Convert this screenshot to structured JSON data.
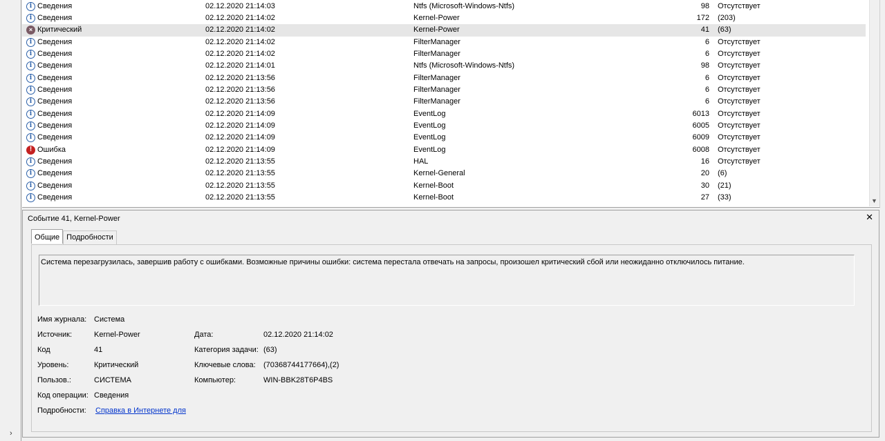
{
  "events": [
    {
      "level": "Сведения",
      "type": "info",
      "date": "02.12.2020 21:14:03",
      "source": "Ntfs (Microsoft-Windows-Ntfs)",
      "id": "98",
      "category": "Отсутствует"
    },
    {
      "level": "Сведения",
      "type": "info",
      "date": "02.12.2020 21:14:02",
      "source": "Kernel-Power",
      "id": "172",
      "category": "(203)"
    },
    {
      "level": "Критический",
      "type": "crit",
      "date": "02.12.2020 21:14:02",
      "source": "Kernel-Power",
      "id": "41",
      "category": "(63)",
      "selected": true
    },
    {
      "level": "Сведения",
      "type": "info",
      "date": "02.12.2020 21:14:02",
      "source": "FilterManager",
      "id": "6",
      "category": "Отсутствует"
    },
    {
      "level": "Сведения",
      "type": "info",
      "date": "02.12.2020 21:14:02",
      "source": "FilterManager",
      "id": "6",
      "category": "Отсутствует"
    },
    {
      "level": "Сведения",
      "type": "info",
      "date": "02.12.2020 21:14:01",
      "source": "Ntfs (Microsoft-Windows-Ntfs)",
      "id": "98",
      "category": "Отсутствует"
    },
    {
      "level": "Сведения",
      "type": "info",
      "date": "02.12.2020 21:13:56",
      "source": "FilterManager",
      "id": "6",
      "category": "Отсутствует"
    },
    {
      "level": "Сведения",
      "type": "info",
      "date": "02.12.2020 21:13:56",
      "source": "FilterManager",
      "id": "6",
      "category": "Отсутствует"
    },
    {
      "level": "Сведения",
      "type": "info",
      "date": "02.12.2020 21:13:56",
      "source": "FilterManager",
      "id": "6",
      "category": "Отсутствует"
    },
    {
      "level": "Сведения",
      "type": "info",
      "date": "02.12.2020 21:14:09",
      "source": "EventLog",
      "id": "6013",
      "category": "Отсутствует"
    },
    {
      "level": "Сведения",
      "type": "info",
      "date": "02.12.2020 21:14:09",
      "source": "EventLog",
      "id": "6005",
      "category": "Отсутствует"
    },
    {
      "level": "Сведения",
      "type": "info",
      "date": "02.12.2020 21:14:09",
      "source": "EventLog",
      "id": "6009",
      "category": "Отсутствует"
    },
    {
      "level": "Ошибка",
      "type": "err",
      "date": "02.12.2020 21:14:09",
      "source": "EventLog",
      "id": "6008",
      "category": "Отсутствует"
    },
    {
      "level": "Сведения",
      "type": "info",
      "date": "02.12.2020 21:13:55",
      "source": "HAL",
      "id": "16",
      "category": "Отсутствует"
    },
    {
      "level": "Сведения",
      "type": "info",
      "date": "02.12.2020 21:13:55",
      "source": "Kernel-General",
      "id": "20",
      "category": "(6)"
    },
    {
      "level": "Сведения",
      "type": "info",
      "date": "02.12.2020 21:13:55",
      "source": "Kernel-Boot",
      "id": "30",
      "category": "(21)"
    },
    {
      "level": "Сведения",
      "type": "info",
      "date": "02.12.2020 21:13:55",
      "source": "Kernel-Boot",
      "id": "27",
      "category": "(33)"
    }
  ],
  "icons": {
    "info": "info-icon",
    "crit": "critical-icon",
    "err": "error-icon"
  },
  "colors": {
    "info": "#2a5fa8",
    "critical": "#7a5a64",
    "error": "#c42121",
    "link": "#0033cc",
    "selected_row": "#e6e6e6"
  },
  "details": {
    "title": "Событие 41, Kernel-Power",
    "close": "✕",
    "tabs": [
      "Общие",
      "Подробности"
    ],
    "active_tab": "Общие",
    "description": "Система перезагрузилась, завершив работу с ошибками. Возможные причины ошибки: система перестала отвечать на запросы, произошел критический сбой или неожиданно отключилось питание.",
    "fields": {
      "log_name": {
        "label": "Имя журнала:",
        "value": "Система"
      },
      "source": {
        "label": "Источник:",
        "value": "Kernel-Power"
      },
      "date": {
        "label": "Дата:",
        "value": "02.12.2020 21:14:02"
      },
      "code": {
        "label": "Код",
        "value": "41"
      },
      "task_category": {
        "label": "Категория задачи:",
        "value": "(63)"
      },
      "level": {
        "label": "Уровень:",
        "value": "Критический"
      },
      "keywords": {
        "label": "Ключевые слова:",
        "value": "(70368744177664),(2)"
      },
      "user": {
        "label": "Пользов.:",
        "value": "СИСТЕМА"
      },
      "computer": {
        "label": "Компьютер:",
        "value": "WIN-BBK28T6P4BS"
      },
      "opcode": {
        "label": "Код операции:",
        "value": "Сведения"
      },
      "more_info": {
        "label": "Подробности:",
        "value": "Справка в Интернете для"
      }
    }
  },
  "left": {
    "expander": "›"
  }
}
